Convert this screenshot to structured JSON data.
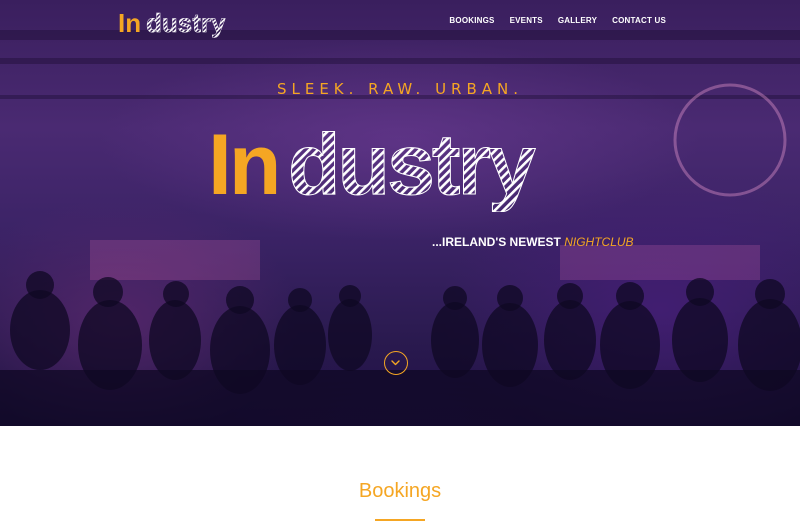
{
  "colors": {
    "accent": "#f5a623",
    "hero_bg": "#3a1f5e",
    "text": "#ffffff"
  },
  "brand": {
    "prefix": "In",
    "suffix": "dustry"
  },
  "nav": {
    "items": [
      {
        "label": "BOOKINGS"
      },
      {
        "label": "EVENTS"
      },
      {
        "label": "GALLERY"
      },
      {
        "label": "CONTACT US"
      }
    ]
  },
  "hero": {
    "tagline": "SLEEK. RAW. URBAN.",
    "subtitle_prefix": "...IRELAND'S NEWEST ",
    "subtitle_highlight": "NIGHTCLUB",
    "scroll_icon": "chevron-down-icon"
  },
  "bookings": {
    "title": "Bookings"
  }
}
